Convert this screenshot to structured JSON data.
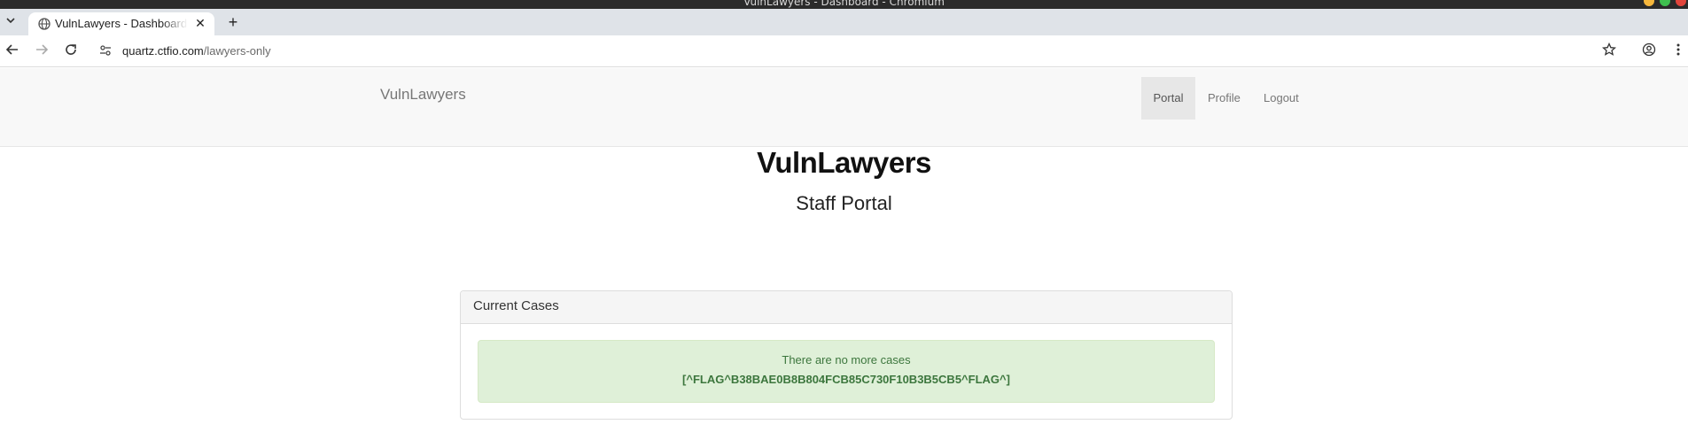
{
  "window": {
    "title": "VulnLawyers - Dashboard - Chromium"
  },
  "browser": {
    "tab": {
      "title": "VulnLawyers - Dashboard"
    },
    "url": {
      "host": "quartz.ctfio.com",
      "path": "/lawyers-only"
    }
  },
  "navbar": {
    "brand": "VulnLawyers",
    "items": [
      {
        "label": "Portal",
        "active": true
      },
      {
        "label": "Profile",
        "active": false
      },
      {
        "label": "Logout",
        "active": false
      }
    ]
  },
  "main": {
    "title": "VulnLawyers",
    "subtitle": "Staff Portal",
    "panel": {
      "heading": "Current Cases",
      "alert": {
        "message": "There are no more cases",
        "flag": "[^FLAG^B38BAE0B8B804FCB85C730F10B3B5CB5^FLAG^]"
      }
    }
  },
  "colors": {
    "alert_bg": "#dff0d8",
    "alert_text": "#3c763d",
    "navbar_bg": "#f8f8f8"
  }
}
